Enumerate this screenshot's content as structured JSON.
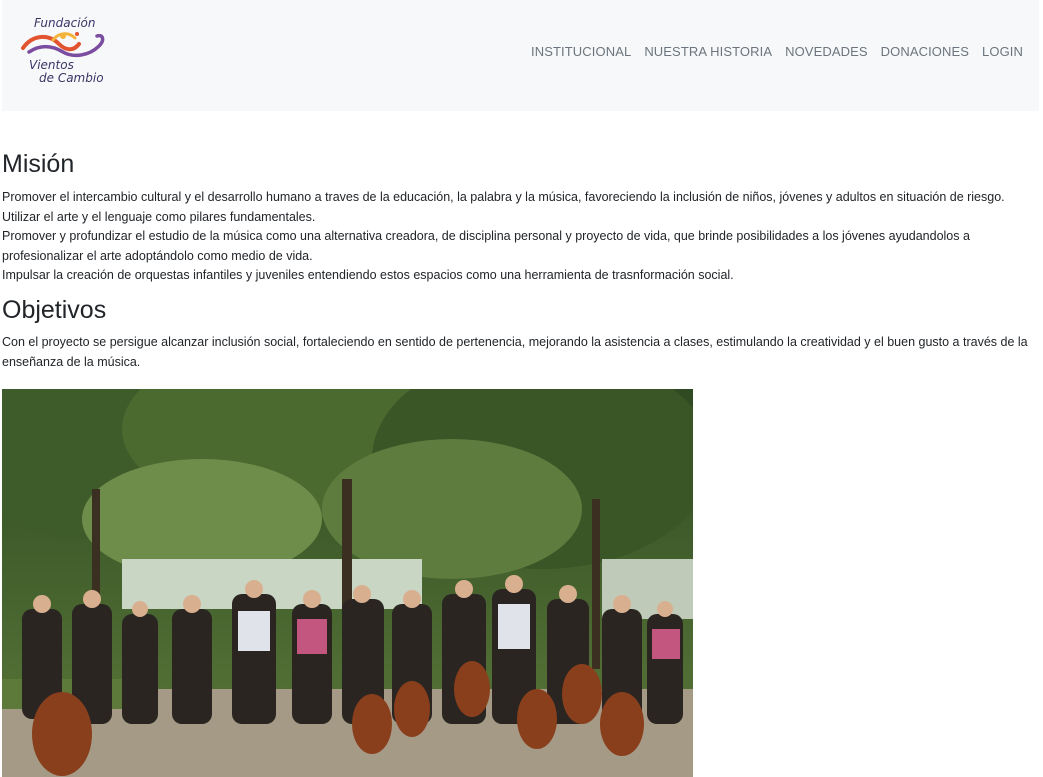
{
  "logo": {
    "line1": "Fundación",
    "line2": "Vientos",
    "line3": "de Cambio"
  },
  "nav": {
    "items": [
      "INSTITUCIONAL",
      "NUESTRA HISTORIA",
      "NOVEDADES",
      "DONACIONES",
      "LOGIN"
    ]
  },
  "mision": {
    "title": "Misión",
    "lines": [
      "Promover el intercambio cultural y el desarrollo humano a traves de la educación, la palabra y la música, favoreciendo la inclusión de niños, jóvenes y adultos en situación de riesgo.",
      "Utilizar el arte y el lenguaje como pilares fundamentales.",
      "Promover y profundizar el estudio de la música como una alternativa creadora, de disciplina personal y proyecto de vida, que brinde posibilidades a los jóvenes ayudandolos a",
      "profesionalizar el arte adoptándolo como medio de vida.",
      "Impulsar la creación de orquestas infantiles y juveniles entendiendo estos espacios como una herramienta de trasnformación social."
    ]
  },
  "objetivos": {
    "title": "Objetivos",
    "lines": [
      "Con el proyecto se persigue alcanzar inclusión social, fortaleciendo en sentido de pertenencia, mejorando la asistencia a clases, estimulando la creatividad y el buen gusto a través de la",
      "enseñanza de la música."
    ]
  }
}
